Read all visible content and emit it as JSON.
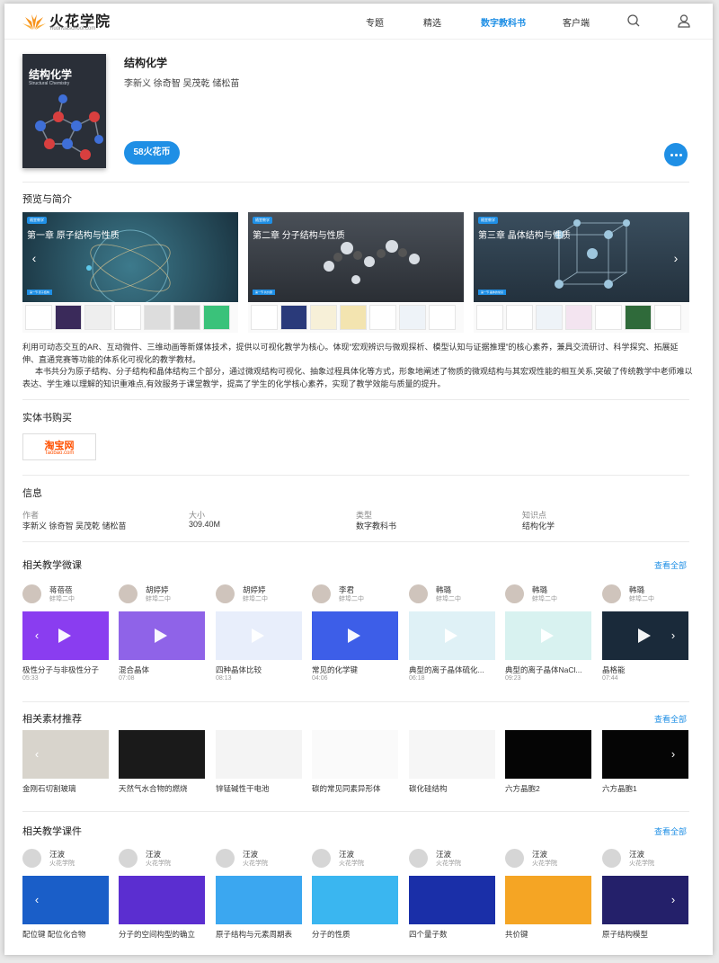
{
  "header": {
    "logo_name": "火花学院",
    "logo_sub": "huohuaschool.com",
    "nav": [
      {
        "label": "专题",
        "active": false
      },
      {
        "label": "精选",
        "active": false
      },
      {
        "label": "数字教科书",
        "active": true
      },
      {
        "label": "客户端",
        "active": false
      }
    ],
    "icons": [
      "search-icon",
      "user-icon"
    ]
  },
  "book": {
    "cover_title": "结构化学",
    "cover_subtitle": "Structural Chemistry",
    "title": "结构化学",
    "authors": "李新义 徐奇智 吴茂乾 储松苗",
    "price_label": "58火花币"
  },
  "preview": {
    "section_title": "预览与简介",
    "slides": [
      {
        "tag": "随堂教学",
        "chapter": "第一章 原子结构与性质",
        "sub": "第一节 原子结构"
      },
      {
        "tag": "随堂教学",
        "chapter": "第二章 分子结构与性质",
        "sub": "第一节 共价键"
      },
      {
        "tag": "随堂教学",
        "chapter": "第三章 晶体结构与性质",
        "sub": "第一节 晶体的常识"
      }
    ],
    "paragraphs": [
      "利用可动态交互的AR、互动微件、三维动画等新媒体技术，提供以可视化教学为核心。体现“宏观辨识与微观探析、模型认知与证据推理”的核心素养，兼具交流研讨、科学探究、拓展延伸、直通竞赛等功能的体系化可视化的教学教材。",
      "本书共分为原子结构、分子结构和晶体结构三个部分，通过微观结构可视化、抽象过程具体化等方式，形象地阐述了物质的微观结构与其宏观性能的相互关系,突破了传统教学中老师难以表达、学生难以理解的知识重难点,有效服务于课堂教学，提高了学生的化学核心素养，实现了教学效能与质量的提升。"
    ]
  },
  "purchase": {
    "section_title": "实体书购买",
    "store_name": "淘宝网",
    "store_sub": "Taobao.com"
  },
  "info": {
    "section_title": "信息",
    "fields": [
      {
        "label": "作者",
        "value": "李新义 徐奇智 吴茂乾 储松苗"
      },
      {
        "label": "大小",
        "value": "309.40M"
      },
      {
        "label": "类型",
        "value": "数字教科书"
      },
      {
        "label": "知识点",
        "value": "结构化学"
      }
    ]
  },
  "micro_lessons": {
    "section_title": "相关教学微课",
    "see_all": "查看全部",
    "items": [
      {
        "author": "蒋蓓蓓",
        "org": "蚌埠二中",
        "title": "极性分子与非极性分子",
        "duration": "05:33",
        "color": "#8a3df0"
      },
      {
        "author": "胡婷婷",
        "org": "蚌埠二中",
        "title": "混合晶体",
        "duration": "07:08",
        "color": "#8f63e8"
      },
      {
        "author": "胡婷婷",
        "org": "蚌埠二中",
        "title": "四种晶体比较",
        "duration": "08:13",
        "color": "#e8eefb"
      },
      {
        "author": "李君",
        "org": "蚌埠二中",
        "title": "常见的化学键",
        "duration": "04:06",
        "color": "#3d5ee8"
      },
      {
        "author": "韩璐",
        "org": "蚌埠二中",
        "title": "典型的离子晶体硫化...",
        "duration": "06:18",
        "color": "#dff1f6"
      },
      {
        "author": "韩璐",
        "org": "蚌埠二中",
        "title": "典型的离子晶体NaCl...",
        "duration": "09:23",
        "color": "#d8f2f0"
      },
      {
        "author": "韩璐",
        "org": "蚌埠二中",
        "title": "晶格能",
        "duration": "07:44",
        "color": "#1a2a3a"
      }
    ]
  },
  "materials": {
    "section_title": "相关素材推荐",
    "see_all": "查看全部",
    "items": [
      {
        "title": "金刚石切割玻璃",
        "color": "#d8d4cc"
      },
      {
        "title": "天然气水合物的燃烧",
        "color": "#1a1a1a"
      },
      {
        "title": "锌锰碱性干电池",
        "color": "#f4f4f4"
      },
      {
        "title": "碳的常见同素异形体",
        "color": "#fafafa"
      },
      {
        "title": "碳化硅结构",
        "color": "#f6f6f6"
      },
      {
        "title": "六方晶胞2",
        "color": "#050505"
      },
      {
        "title": "六方晶胞1",
        "color": "#050505"
      }
    ]
  },
  "courseware": {
    "section_title": "相关教学课件",
    "see_all": "查看全部",
    "items": [
      {
        "author": "汪波",
        "org": "火花学院",
        "title": "配位键 配位化合物",
        "color": "#1a5ec8"
      },
      {
        "author": "汪波",
        "org": "火花学院",
        "title": "分子的空间构型的确立",
        "color": "#5b2ed0"
      },
      {
        "author": "汪波",
        "org": "火花学院",
        "title": "原子结构与元素周期表",
        "color": "#3ba7f0"
      },
      {
        "author": "汪波",
        "org": "火花学院",
        "title": "分子的性质",
        "color": "#3ab6f0"
      },
      {
        "author": "汪波",
        "org": "火花学院",
        "title": "四个量子数",
        "color": "#1a2fa8"
      },
      {
        "author": "汪波",
        "org": "火花学院",
        "title": "共价键",
        "color": "#f5a524"
      },
      {
        "author": "汪波",
        "org": "火花学院",
        "title": "原子结构模型",
        "color": "#24206a"
      }
    ]
  }
}
